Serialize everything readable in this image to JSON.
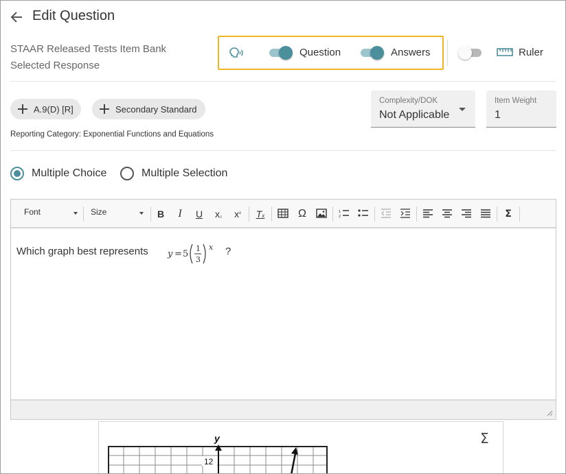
{
  "header": {
    "title": "Edit Question",
    "bank_line1": "STAAR Released Tests Item Bank",
    "bank_line2": "Selected Response"
  },
  "toggles": {
    "question": {
      "label": "Question",
      "on": true
    },
    "answers": {
      "label": "Answers",
      "on": true
    },
    "ruler": {
      "label": "Ruler",
      "on": false
    }
  },
  "standards": {
    "primary": "A.9(D) [R]",
    "secondary": "Secondary Standard",
    "reporting_category": "Reporting Category: Exponential Functions and Equations"
  },
  "fields": {
    "complexity": {
      "label": "Complexity/DOK",
      "value": "Not Applicable"
    },
    "weight": {
      "label": "Item Weight",
      "value": "1"
    }
  },
  "question_type": {
    "options": [
      "Multiple Choice",
      "Multiple Selection"
    ],
    "selected": "Multiple Choice"
  },
  "toolbar": {
    "font": "Font",
    "size": "Size",
    "buttons": [
      "bold",
      "italic",
      "underline",
      "subscript",
      "superscript",
      "remove-format",
      "table",
      "special-character",
      "image",
      "numbered-list",
      "bulleted-list",
      "decrease-indent",
      "increase-indent",
      "align-left",
      "align-center",
      "align-right",
      "justify",
      "math"
    ]
  },
  "editor": {
    "question_text": "Which graph best represents",
    "formula": {
      "var": "y",
      "coef": "5",
      "num": "1",
      "den": "3",
      "exp": "x"
    },
    "question_end": "?"
  },
  "answer_graph": {
    "axis_label": "y",
    "tick_label": "12"
  },
  "colors": {
    "accent": "#4b8f9d",
    "highlight": "#f2b41f"
  }
}
